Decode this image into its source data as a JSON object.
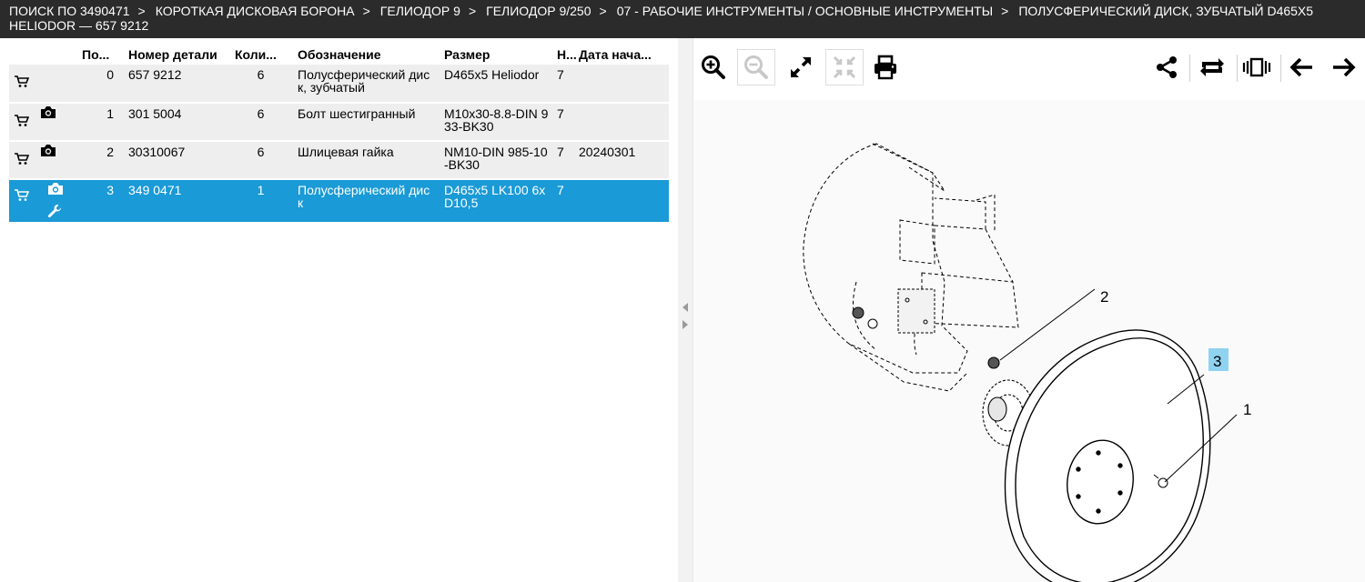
{
  "breadcrumb": {
    "items": [
      "ПОИСК ПО 3490471",
      "КОРОТКАЯ ДИСКОВАЯ БОРОНА",
      "ГЕЛИОДОР 9",
      "ГЕЛИОДОР 9/250",
      "07 - РАБОЧИЕ ИНСТРУМЕНТЫ / ОСНОВНЫЕ ИНСТРУМЕНТЫ",
      "ПОЛУСФЕРИЧЕСКИЙ ДИСК, ЗУБЧАТЫЙ D465X5 HELIODOR — 657 9212"
    ],
    "separator": ">"
  },
  "table": {
    "headers": {
      "position": "По...",
      "part_number": "Номер детали",
      "quantity": "Коли...",
      "designation": "Обозначение",
      "size": "Размер",
      "n": "Н...",
      "date": "Дата нача..."
    },
    "rows": [
      {
        "pos": "0",
        "part": "657 9212",
        "qty": "6",
        "name": "Полусферический диск, зубчатый",
        "size": "D465x5 Heliodor",
        "n": "7",
        "date": "",
        "has_camera": false,
        "has_wrench": false,
        "selected": false
      },
      {
        "pos": "1",
        "part": "301 5004",
        "qty": "6",
        "name": "Болт шестигранный",
        "size": "M10x30-8.8-DIN 933-BK30",
        "n": "7",
        "date": "",
        "has_camera": true,
        "has_wrench": false,
        "selected": false
      },
      {
        "pos": "2",
        "part": "30310067",
        "qty": "6",
        "name": "Шлицевая гайка",
        "size": "NM10-DIN 985-10-BK30",
        "n": "7",
        "date": "20240301",
        "has_camera": true,
        "has_wrench": false,
        "selected": false
      },
      {
        "pos": "3",
        "part": "349 0471",
        "qty": "1",
        "name": "Полусферический диск",
        "size": "D465x5 LK100 6xD10,5",
        "n": "7",
        "date": "",
        "has_camera": true,
        "has_wrench": true,
        "selected": true
      }
    ]
  },
  "toolbar": {
    "icons": [
      "zoom-in-icon",
      "zoom-out-icon",
      "expand-icon",
      "fit-icon",
      "print-icon",
      "share-icon",
      "refresh-icon",
      "carousel-icon",
      "arrow-left-icon",
      "arrow-right-icon"
    ]
  },
  "drawing": {
    "callouts": [
      "1",
      "2",
      "3"
    ],
    "highlight_color": "#8fd3f0"
  },
  "colors": {
    "header_bg": "#2b2b2b",
    "row_bg": "#eeeeee",
    "selected_bg": "#1a9ad6"
  }
}
